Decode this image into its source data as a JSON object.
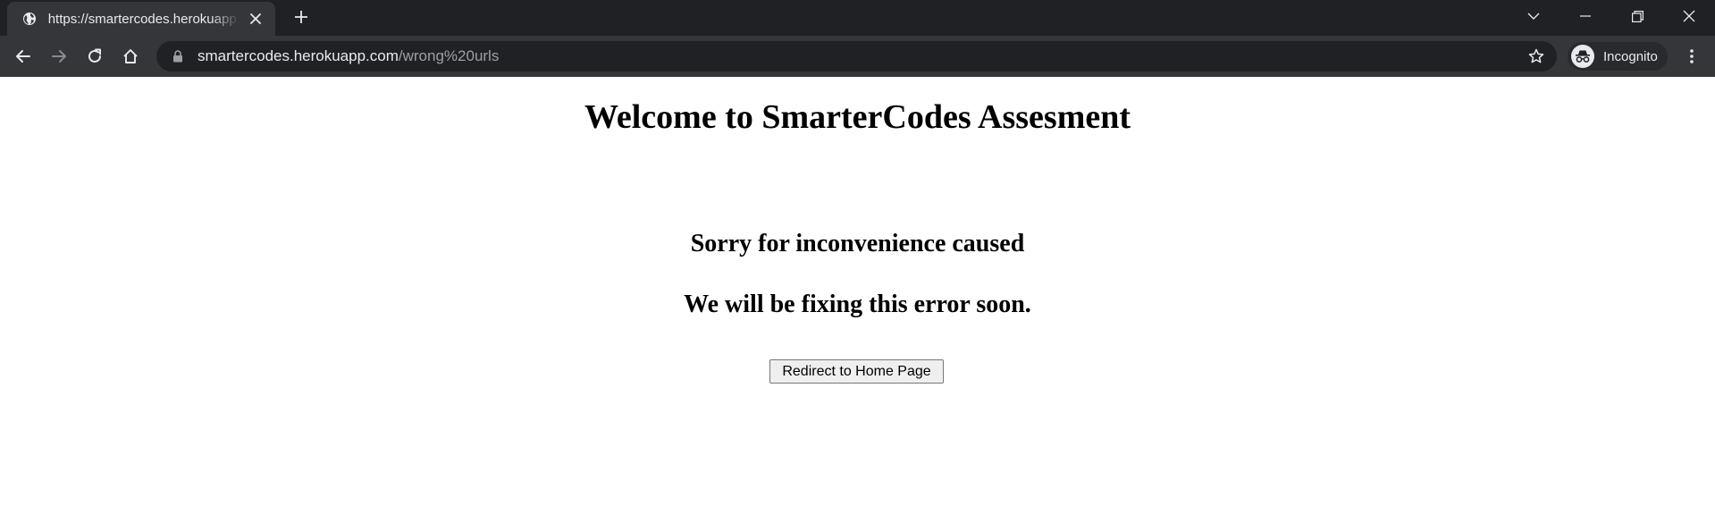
{
  "browser": {
    "tab": {
      "title": "https://smartercodes.herokuapp.com/wrong%20urls",
      "favicon": "globe-icon",
      "close_icon": "close-icon"
    },
    "new_tab_icon": "plus-icon",
    "window_controls": [
      "chevron-down-icon",
      "minimize-icon",
      "restore-icon",
      "close-icon"
    ],
    "nav": [
      "back-arrow-icon",
      "forward-arrow-icon",
      "reload-icon",
      "home-icon"
    ],
    "omnibox": {
      "lock_icon": "lock-icon",
      "url_host": "smartercodes.herokuapp.com",
      "url_path": "/wrong%20urls",
      "star_icon": "star-icon"
    },
    "profile": {
      "label": "Incognito",
      "icon": "incognito-icon"
    },
    "menu_icon": "kebab-menu-icon",
    "colors": {
      "tabstrip_bg": "#202124",
      "toolbar_bg": "#35363a",
      "omnibox_bg": "#202124",
      "text": "#e8eaed",
      "muted_text": "#9aa0a6"
    }
  },
  "page": {
    "heading": "Welcome to SmarterCodes Assesment",
    "message_line1": "Sorry for inconvenience caused",
    "message_line2": "We will be fixing this error soon.",
    "redirect_button_label": "Redirect to Home Page"
  }
}
